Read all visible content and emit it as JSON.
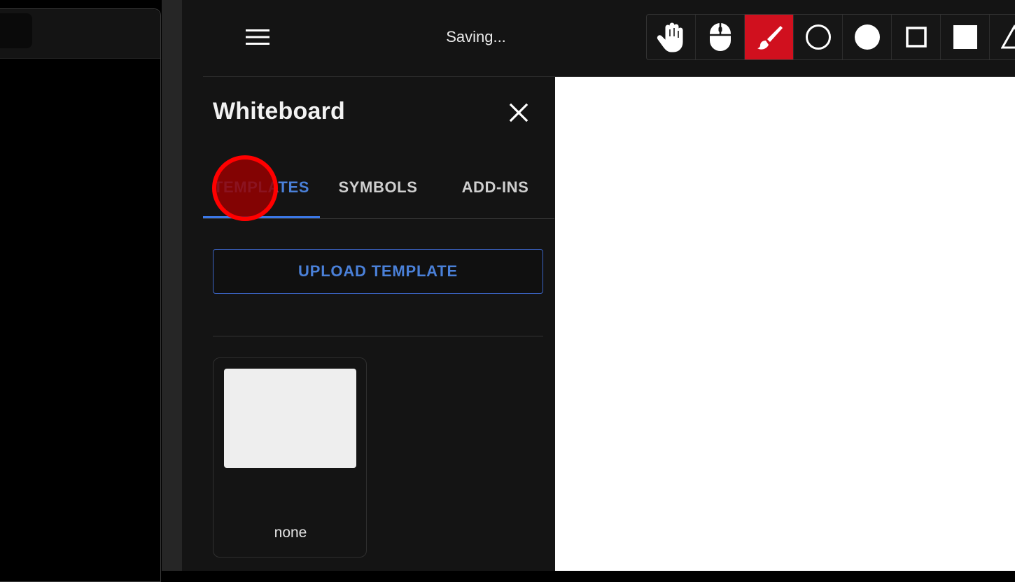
{
  "header": {
    "status": "Saving..."
  },
  "icons": {
    "menu": "hamburger-menu-icon",
    "close": "close-icon"
  },
  "toolbar": {
    "accent_color": "#d0101e",
    "tools": [
      {
        "name": "pan",
        "icon": "hand-icon",
        "active": false
      },
      {
        "name": "select",
        "icon": "mouse-icon",
        "active": false
      },
      {
        "name": "brush",
        "icon": "brush-icon",
        "active": true
      },
      {
        "name": "circle-outline",
        "icon": "circle-outline-icon",
        "active": false
      },
      {
        "name": "circle-filled",
        "icon": "circle-filled-icon",
        "active": false
      },
      {
        "name": "square-outline",
        "icon": "square-outline-icon",
        "active": false
      },
      {
        "name": "square-filled",
        "icon": "square-filled-icon",
        "active": false
      },
      {
        "name": "triangle",
        "icon": "triangle-icon",
        "active": false
      }
    ]
  },
  "drawer": {
    "title": "Whiteboard",
    "tabs": [
      {
        "label": "TEMPLATES",
        "active": true
      },
      {
        "label": "SYMBOLS",
        "active": false
      },
      {
        "label": "ADD-INS",
        "active": false
      }
    ],
    "upload_label": "UPLOAD TEMPLATE",
    "templates": [
      {
        "name": "none"
      }
    ]
  },
  "colors": {
    "tab_active": "#4a80d8",
    "click_marker": "#ff0000"
  }
}
